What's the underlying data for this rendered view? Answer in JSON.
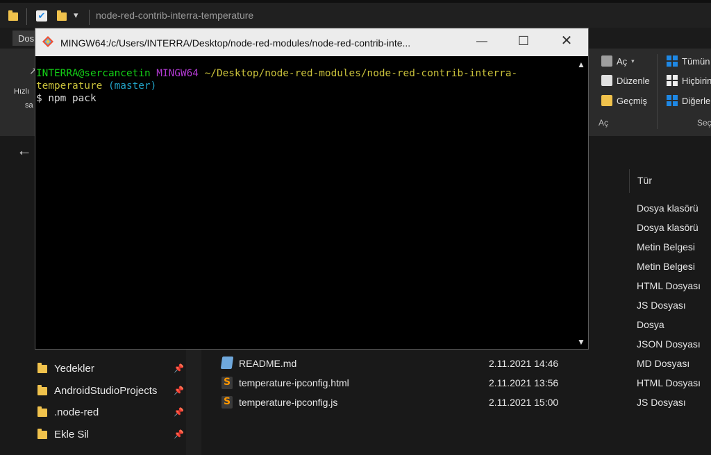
{
  "explorer": {
    "title": "node-red-contrib-interra-temperature",
    "tab_file": "Dos",
    "ribbon": {
      "open_label": "Aç",
      "edit_label": "Düzenle",
      "history_label": "Geçmiş",
      "open_group": "Aç",
      "select_all": "Tümün",
      "select_none": "Hiçbirin",
      "invert": "Diğerle",
      "select_group": "Seç",
      "left_labels": [
        "Hızlı",
        "sa"
      ]
    },
    "columns": {
      "type": "Tür"
    },
    "type_column_values": [
      "Dosya klasörü",
      "Dosya klasörü",
      "Metin Belgesi",
      "Metin Belgesi",
      "HTML Dosyası",
      "JS Dosyası",
      "Dosya",
      "JSON Dosyası",
      "MD Dosyası",
      "HTML Dosyası",
      "JS Dosyası"
    ],
    "files": [
      {
        "name": "README.md",
        "date": "2.11.2021 14:46",
        "icon": "markdown-file-icon"
      },
      {
        "name": "temperature-ipconfig.html",
        "date": "2.11.2021 13:56",
        "icon": "sublime-file-icon"
      },
      {
        "name": "temperature-ipconfig.js",
        "date": "2.11.2021 15:00",
        "icon": "sublime-file-icon"
      }
    ],
    "sidebar_items": [
      {
        "label": "Yedekler"
      },
      {
        "label": "AndroidStudioProjects"
      },
      {
        "label": ".node-red"
      },
      {
        "label": "Ekle Sil"
      }
    ]
  },
  "terminal": {
    "title": "MINGW64:/c/Users/INTERRA/Desktop/node-red-modules/node-red-contrib-inte...",
    "user_host": "INTERRA@sercancetin",
    "env": "MINGW64",
    "path_line1": "~/Desktop/node-red-modules/node-red-contrib-interra-",
    "path_line2": "temperature",
    "branch": "(master)",
    "command": "$ npm pack"
  },
  "colors": {
    "accent_green": "#13d116",
    "accent_magenta": "#b13ad1",
    "accent_yellow": "#c9c13b",
    "accent_cyan": "#22a3c7"
  }
}
